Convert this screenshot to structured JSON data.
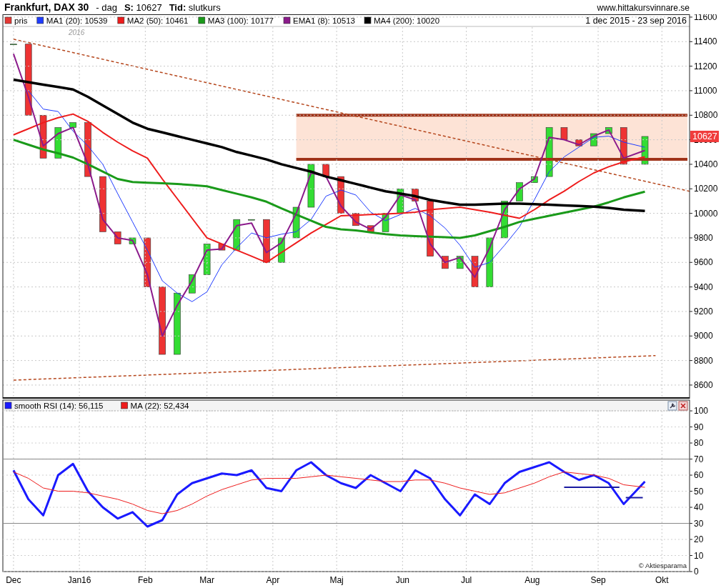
{
  "header": {
    "title": "Frankfurt, DAX 30",
    "period": "- dag",
    "price": "**S:** 10627",
    "mode": "**Tid:** slutkurs",
    "website": "www.hittakursvinnare.se"
  },
  "main_chart": {
    "date_range": "1 dec 2015 - 23 sep 2016",
    "year_label": "2016",
    "last_price_tag": "10627",
    "price_legend": {
      "label": "pris",
      "color": "#e53935"
    },
    "chart_data": {
      "type": "line",
      "x": [
        "2015-12-01",
        "2015-12-08",
        "2015-12-15",
        "2015-12-22",
        "2015-12-29",
        "2016-01-05",
        "2016-01-12",
        "2016-01-19",
        "2016-01-26",
        "2016-02-02",
        "2016-02-09",
        "2016-02-16",
        "2016-02-23",
        "2016-03-01",
        "2016-03-08",
        "2016-03-15",
        "2016-03-22",
        "2016-03-29",
        "2016-04-05",
        "2016-04-12",
        "2016-04-19",
        "2016-04-26",
        "2016-05-03",
        "2016-05-10",
        "2016-05-17",
        "2016-05-24",
        "2016-05-31",
        "2016-06-07",
        "2016-06-14",
        "2016-06-21",
        "2016-06-28",
        "2016-07-05",
        "2016-07-12",
        "2016-07-19",
        "2016-07-26",
        "2016-08-02",
        "2016-08-09",
        "2016-08-16",
        "2016-08-23",
        "2016-08-30",
        "2016-09-06",
        "2016-09-13",
        "2016-09-23"
      ],
      "series": [
        {
          "name": "MA1 (20): 10539",
          "color": "#1f3cff",
          "values": [
            null,
            11000,
            10850,
            10830,
            10670,
            10550,
            10400,
            10160,
            9930,
            9700,
            9450,
            9350,
            9280,
            9360,
            9580,
            9720,
            9840,
            9800,
            9830,
            9850,
            9950,
            10140,
            10190,
            10150,
            10010,
            9940,
            9990,
            10040,
            9980,
            9880,
            9740,
            9560,
            9600,
            9740,
            9890,
            10110,
            10340,
            10460,
            10540,
            10620,
            10630,
            10580,
            10539
          ]
        },
        {
          "name": "MA2 (50): 10461",
          "color": "#ee1c1c",
          "values": [
            10640,
            10690,
            10740,
            10780,
            10810,
            10750,
            10660,
            10580,
            10510,
            10450,
            10280,
            10120,
            9960,
            9800,
            9750,
            9700,
            9650,
            9600,
            9680,
            9760,
            9840,
            9910,
            9980,
            9985,
            9990,
            9995,
            10000,
            10010,
            10030,
            10040,
            10050,
            10030,
            10010,
            9985,
            9960,
            10030,
            10110,
            10180,
            10260,
            10330,
            10380,
            10420,
            10461
          ]
        },
        {
          "name": "MA3 (100): 10177",
          "color": "#1a9a1a",
          "values": [
            10600,
            10560,
            10520,
            10490,
            10455,
            10400,
            10340,
            10280,
            10255,
            10250,
            10245,
            10240,
            10230,
            10220,
            10190,
            10160,
            10130,
            10095,
            10040,
            9990,
            9940,
            9890,
            9870,
            9860,
            9845,
            9830,
            9820,
            9815,
            9810,
            9805,
            9800,
            9820,
            9855,
            9890,
            9930,
            9955,
            9980,
            10005,
            10030,
            10055,
            10090,
            10130,
            10177
          ]
        },
        {
          "name": "EMA1 (8): 10513",
          "color": "#8b1a8b",
          "values": [
            11300,
            10950,
            10550,
            10650,
            10700,
            10400,
            9950,
            9800,
            9780,
            9500,
            9000,
            9250,
            9450,
            9700,
            9710,
            9900,
            9920,
            9680,
            9760,
            10000,
            10330,
            10300,
            10060,
            9930,
            9870,
            9970,
            10150,
            10110,
            9750,
            9600,
            9640,
            9480,
            9720,
            10030,
            10200,
            10280,
            10620,
            10600,
            10560,
            10630,
            10680,
            10450,
            10513
          ]
        },
        {
          "name": "MA4 (200): 10020",
          "color": "#000000",
          "values": [
            11090,
            11070,
            11050,
            11030,
            11010,
            10950,
            10880,
            10810,
            10740,
            10690,
            10660,
            10630,
            10600,
            10570,
            10540,
            10500,
            10470,
            10440,
            10400,
            10370,
            10340,
            10300,
            10270,
            10240,
            10210,
            10180,
            10160,
            10140,
            10110,
            10090,
            10070,
            10070,
            10075,
            10080,
            10080,
            10075,
            10070,
            10065,
            10060,
            10055,
            10045,
            10030,
            10020
          ]
        }
      ],
      "xlim": [
        "2015-11-26",
        "2016-10-14"
      ],
      "ylim": [
        8489,
        11623
      ],
      "grid": true,
      "legend": "top-left",
      "yticks": [
        8600,
        8800,
        9000,
        9200,
        9400,
        9600,
        9800,
        10000,
        10200,
        10400,
        10600,
        10800,
        11000,
        11200,
        11400,
        11600
      ]
    }
  },
  "rsi_panel": {
    "copyright": "© Aktiesparama",
    "chart_data": {
      "type": "line",
      "x": [
        "2015-12-01",
        "2015-12-08",
        "2015-12-15",
        "2015-12-22",
        "2015-12-29",
        "2016-01-05",
        "2016-01-12",
        "2016-01-19",
        "2016-01-26",
        "2016-02-02",
        "2016-02-09",
        "2016-02-16",
        "2016-02-23",
        "2016-03-01",
        "2016-03-08",
        "2016-03-15",
        "2016-03-22",
        "2016-03-29",
        "2016-04-05",
        "2016-04-12",
        "2016-04-19",
        "2016-04-26",
        "2016-05-03",
        "2016-05-10",
        "2016-05-17",
        "2016-05-24",
        "2016-05-31",
        "2016-06-07",
        "2016-06-14",
        "2016-06-21",
        "2016-06-28",
        "2016-07-05",
        "2016-07-12",
        "2016-07-19",
        "2016-07-26",
        "2016-08-02",
        "2016-08-09",
        "2016-08-16",
        "2016-08-23",
        "2016-08-30",
        "2016-09-06",
        "2016-09-13",
        "2016-09-23"
      ],
      "series": [
        {
          "name": "smooth RSI (14): 56,115",
          "color": "#1a1aff",
          "values": [
            63,
            45,
            35,
            60,
            67,
            50,
            40,
            33,
            37,
            28,
            32,
            48,
            55,
            58,
            61,
            60,
            63,
            52,
            50,
            63,
            68,
            60,
            55,
            52,
            60,
            55,
            50,
            63,
            58,
            45,
            35,
            48,
            42,
            55,
            62,
            65,
            68,
            62,
            57,
            60,
            55,
            42,
            56
          ]
        },
        {
          "name": "MA (22): 52,434",
          "color": "#ee1c1c",
          "values": [
            62,
            58,
            52,
            50,
            50,
            49,
            47,
            45,
            42,
            38,
            36,
            38,
            42,
            47,
            51,
            54,
            57,
            58,
            58,
            58,
            59,
            60,
            59,
            58,
            57,
            56,
            56,
            57,
            57,
            55,
            52,
            50,
            48,
            49,
            52,
            55,
            59,
            62,
            61,
            60,
            58,
            54,
            52.4
          ]
        }
      ],
      "xlim": [
        "2015-11-26",
        "2016-10-14"
      ],
      "ylim": [
        0,
        106.7
      ],
      "grid": true,
      "legend": "top-left",
      "yticks": [
        0,
        10,
        20,
        30,
        40,
        50,
        60,
        70,
        80,
        90,
        100
      ],
      "xticks": [
        {
          "value": "2015-12-01",
          "label": "Dec"
        },
        {
          "value": "2016-01-01",
          "label": "Jan16"
        },
        {
          "value": "2016-02-01",
          "label": "Feb"
        },
        {
          "value": "2016-03-01",
          "label": "Mar"
        },
        {
          "value": "2016-04-01",
          "label": "Apr"
        },
        {
          "value": "2016-05-01",
          "label": "Maj"
        },
        {
          "value": "2016-06-01",
          "label": "Jun"
        },
        {
          "value": "2016-07-01",
          "label": "Jul"
        },
        {
          "value": "2016-08-01",
          "label": "Aug"
        },
        {
          "value": "2016-09-01",
          "label": "Sep"
        },
        {
          "value": "2016-10-01",
          "label": "Okt"
        }
      ]
    }
  }
}
